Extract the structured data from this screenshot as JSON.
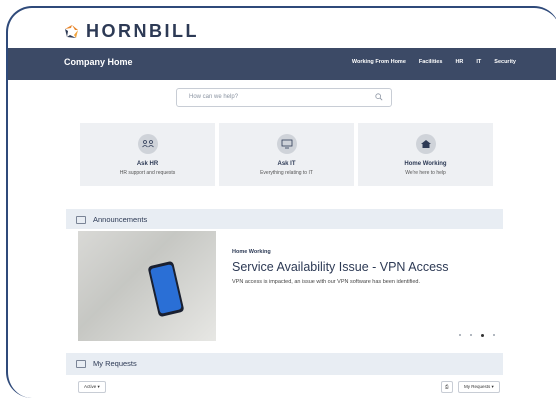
{
  "logo": {
    "text": "HORNBILL"
  },
  "header": {
    "title": "Company Home",
    "nav": [
      "Working From Home",
      "Facilities",
      "HR",
      "IT",
      "Security"
    ]
  },
  "search": {
    "placeholder": "How can we help?",
    "icon": "search-icon"
  },
  "cards": [
    {
      "title": "Ask HR",
      "desc": "HR support and requests",
      "icon": "people-icon"
    },
    {
      "title": "Ask IT",
      "desc": "Everything relating to IT",
      "icon": "monitor-icon"
    },
    {
      "title": "Home Working",
      "desc": "We're here to help",
      "icon": "home-icon"
    }
  ],
  "announcements": {
    "heading": "Announcements",
    "slide": {
      "tag": "Home Working",
      "title": "Service Availability Issue - VPN Access",
      "text": "VPN access is impacted, an issue with our VPN software has been identified."
    },
    "dots_count": 4,
    "active_dot": 3
  },
  "requests": {
    "heading": "My Requests",
    "filter": "Active ▾",
    "view": "My Requests ▾"
  },
  "colors": {
    "topbar": "#3c4a66",
    "accent": "#2d3a55",
    "logo_orange": "#e8862b"
  }
}
